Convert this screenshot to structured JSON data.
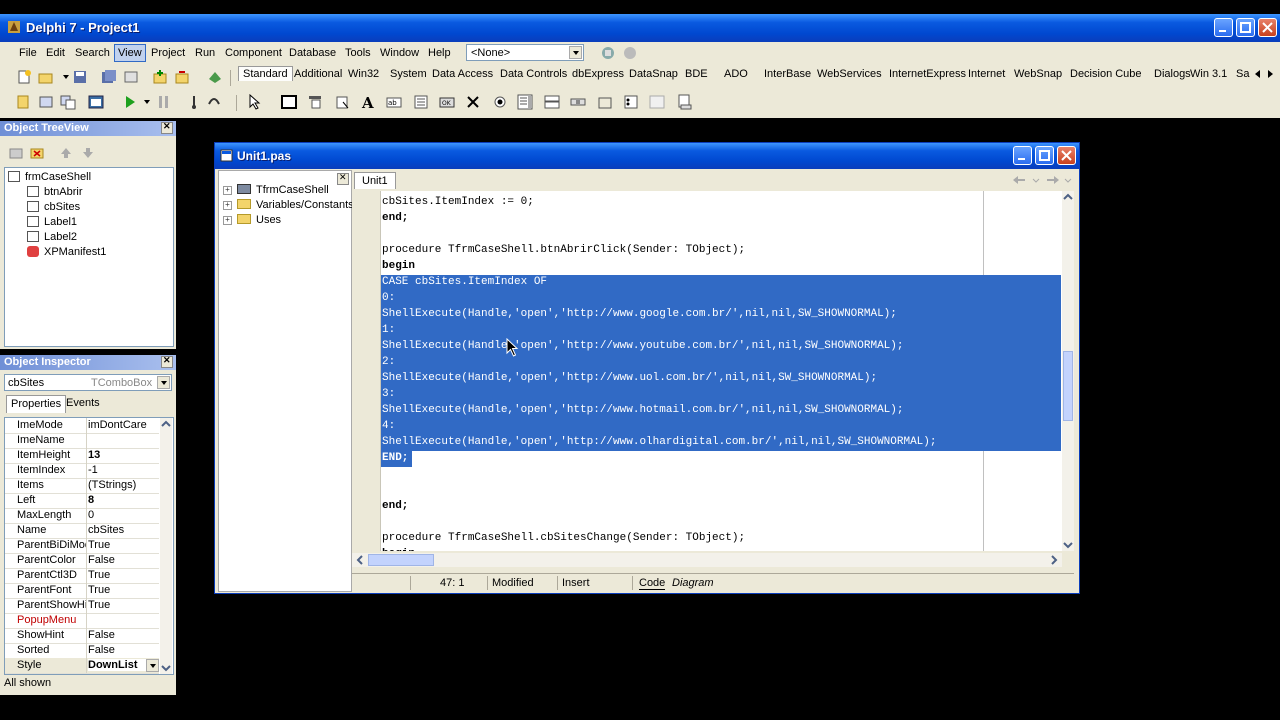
{
  "ide": {
    "title": "Delphi 7 - Project1",
    "menu": [
      "File",
      "Edit",
      "Search",
      "View",
      "Project",
      "Run",
      "Component",
      "Database",
      "Tools",
      "Window",
      "Help"
    ],
    "active_menu": "View",
    "desktop_select": "<None>",
    "palette_tabs": [
      "Standard",
      "Additional",
      "Win32",
      "System",
      "Data Access",
      "Data Controls",
      "dbExpress",
      "DataSnap",
      "BDE",
      "ADO",
      "InterBase",
      "WebServices",
      "InternetExpress",
      "Internet",
      "WebSnap",
      "Decision Cube",
      "Dialogs",
      "Win 3.1",
      "Sa"
    ],
    "selected_palette_tab": "Standard"
  },
  "treeview": {
    "title": "Object TreeView",
    "root": "frmCaseShell",
    "items": [
      "btnAbrir",
      "cbSites",
      "Label1",
      "Label2",
      "XPManifest1"
    ]
  },
  "inspector": {
    "title": "Object Inspector",
    "selected_object": "cbSites",
    "selected_type": "TComboBox",
    "tabs": [
      "Properties",
      "Events"
    ],
    "properties": [
      {
        "name": "ImeMode",
        "value": "imDontCare"
      },
      {
        "name": "ImeName",
        "value": ""
      },
      {
        "name": "ItemHeight",
        "value": "13"
      },
      {
        "name": "ItemIndex",
        "value": "-1"
      },
      {
        "name": "Items",
        "value": "(TStrings)"
      },
      {
        "name": "Left",
        "value": "8"
      },
      {
        "name": "MaxLength",
        "value": "0"
      },
      {
        "name": "Name",
        "value": "cbSites"
      },
      {
        "name": "ParentBiDiMod",
        "value": "True"
      },
      {
        "name": "ParentColor",
        "value": "False"
      },
      {
        "name": "ParentCtl3D",
        "value": "True"
      },
      {
        "name": "ParentFont",
        "value": "True"
      },
      {
        "name": "ParentShowHir",
        "value": "True"
      },
      {
        "name": "PopupMenu",
        "value": ""
      },
      {
        "name": "ShowHint",
        "value": "False"
      },
      {
        "name": "Sorted",
        "value": "False"
      },
      {
        "name": "Style",
        "value": "DownList"
      }
    ],
    "footer": "All shown"
  },
  "editor": {
    "title": "Unit1.pas",
    "tab": "Unit1",
    "explorer": [
      "TfrmCaseShell",
      "Variables/Constants",
      "Uses"
    ],
    "lines": [
      "cbSites.ItemIndex := 0;",
      "end;",
      "",
      "procedure TfrmCaseShell.btnAbrirClick(Sender: TObject);",
      "begin",
      "CASE cbSites.ItemIndex OF",
      "0:",
      "ShellExecute(Handle,'open','http://www.google.com.br/',nil,nil,SW_SHOWNORMAL);",
      "1:",
      "ShellExecute(Handle,'open','http://www.youtube.com.br/',nil,nil,SW_SHOWNORMAL);",
      "2:",
      "ShellExecute(Handle,'open','http://www.uol.com.br/',nil,nil,SW_SHOWNORMAL);",
      "3:",
      "ShellExecute(Handle,'open','http://www.hotmail.com.br/',nil,nil,SW_SHOWNORMAL);",
      "4:",
      "ShellExecute(Handle,'open','http://www.olhardigital.com.br/',nil,nil,SW_SHOWNORMAL);",
      "END;",
      "",
      "",
      "end;",
      "",
      "procedure TfrmCaseShell.cbSitesChange(Sender: TObject);",
      "begin"
    ],
    "status": {
      "position": "47:  1",
      "modified": "Modified",
      "mode": "Insert",
      "code_tab": "Code",
      "diagram_tab": "Diagram"
    }
  },
  "colors": {
    "selection": "#316ac5",
    "titlebar": "#0054e3",
    "face": "#ece9d8"
  }
}
